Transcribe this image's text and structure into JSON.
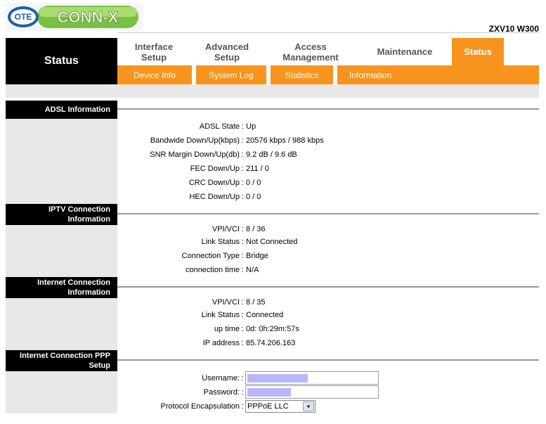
{
  "brand": {
    "logo_prefix": "OTE",
    "logo_name": "CONN-X",
    "model": "ZXV10 W300"
  },
  "status_block": {
    "title": "Status"
  },
  "nav": {
    "tabs": [
      {
        "label_line1": "Interface",
        "label_line2": "Setup"
      },
      {
        "label_line1": "Advanced",
        "label_line2": "Setup"
      },
      {
        "label_line1": "Access",
        "label_line2": "Management"
      },
      {
        "label_line1": "Maintenance",
        "label_line2": ""
      },
      {
        "label_line1": "Status",
        "label_line2": ""
      }
    ],
    "active": "Status"
  },
  "subnav": {
    "items": [
      "Device Info",
      "System Log",
      "Statistics",
      "Information"
    ]
  },
  "adsl": {
    "header": "ADSL Information",
    "rows": [
      {
        "label": "ADSL State",
        "value": "Up"
      },
      {
        "label": "Bandwide Down/Up(kbps)",
        "value": "20576 kbps / 988 kbps"
      },
      {
        "label": "SNR Margin Down/Up(db)",
        "value": "9.2 dB / 9.6 dB"
      },
      {
        "label": "FEC Down/Up",
        "value": "211 / 0"
      },
      {
        "label": "CRC Down/Up",
        "value": "0 / 0"
      },
      {
        "label": "HEC Down/Up",
        "value": "0 / 0"
      }
    ]
  },
  "iptv": {
    "header_line1": "IPTV Connection",
    "header_line2": "Information",
    "rows": [
      {
        "label": "VPI/VCI",
        "value": "8 / 36"
      },
      {
        "label": "Link Status",
        "value": "Not Connected"
      },
      {
        "label": "Connection Type",
        "value": "Bridge"
      },
      {
        "label": "connection time",
        "value": "N/A"
      }
    ]
  },
  "internet": {
    "header_line1": "Internet Connection",
    "header_line2": "Information",
    "rows": [
      {
        "label": "VPI/VCI",
        "value": "8 / 35"
      },
      {
        "label": "Link Status",
        "value": "Connected"
      },
      {
        "label": "up time",
        "value": "0d: 0h:29m:57s"
      },
      {
        "label": "IP address",
        "value": "85.74.206.163"
      }
    ]
  },
  "ppp": {
    "header_line1": "Internet Connection PPP",
    "header_line2": "Setup",
    "username_label": "Username:",
    "password_label": "Password:",
    "protocol_label": "Protocol Encapsulation",
    "protocol_value": "PPPoE LLC"
  },
  "colors": {
    "accent": "#f7941d",
    "header_bg": "#000000",
    "panel_bg": "#e8e8e8",
    "redaction": "#b8b8f8"
  }
}
